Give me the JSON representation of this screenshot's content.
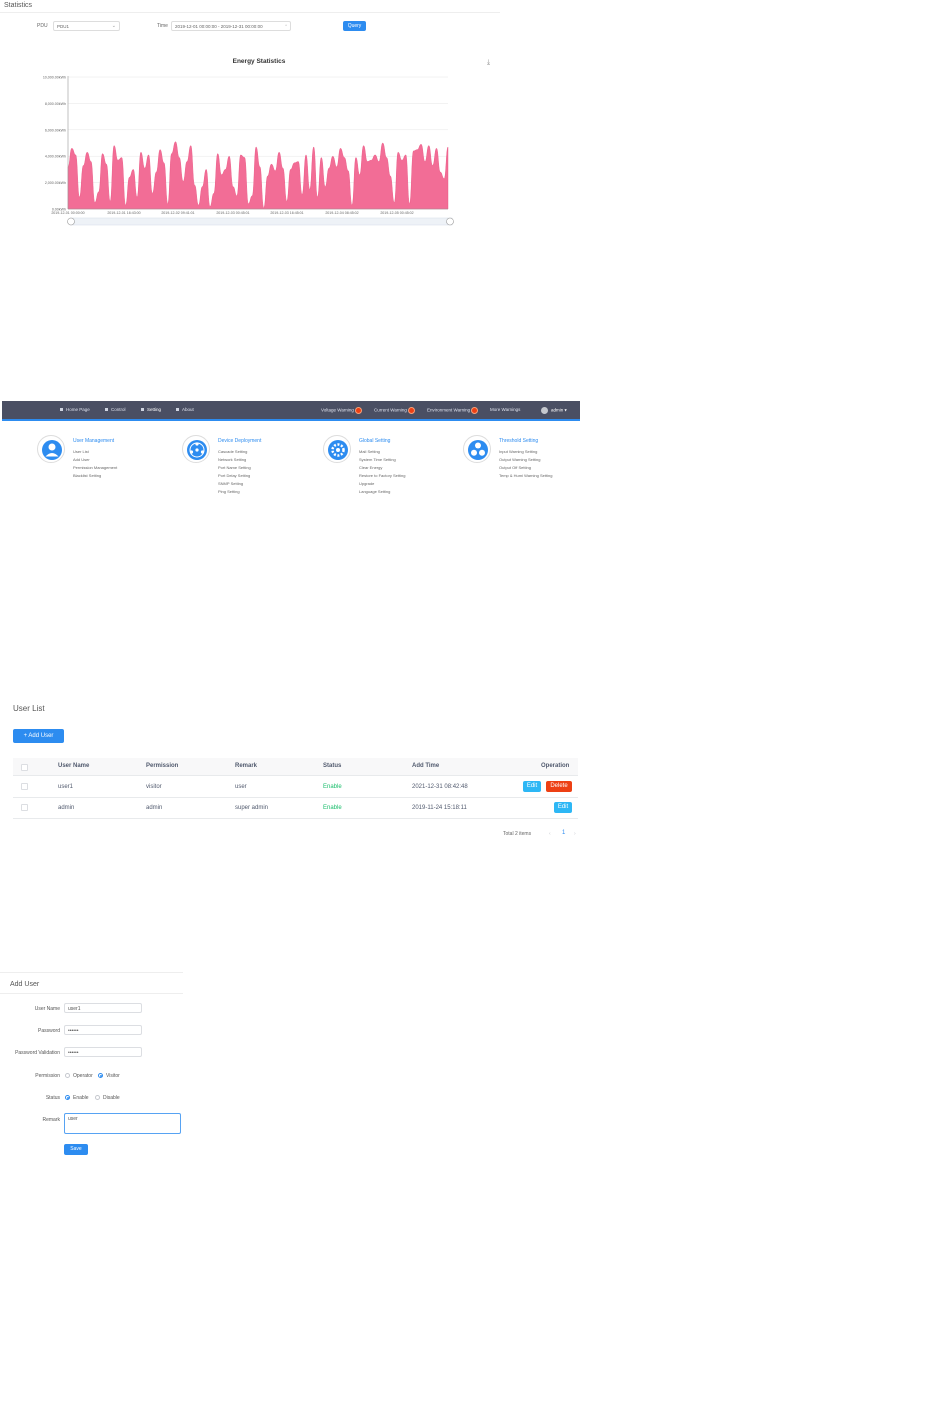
{
  "statistics": {
    "title": "Statistics",
    "pdu_label": "PDU",
    "pdu_value": "PDU1",
    "time_label": "Time",
    "time_value": "2019-12-01 00:00:00 - 2019-12-31 00:00:00",
    "query_label": "Query",
    "download_icon": "download-icon"
  },
  "chart_data": {
    "type": "area",
    "title": "Energy Statistics",
    "ylabel": "",
    "xlabel": "",
    "ylim": [
      0,
      10000
    ],
    "yticks": [
      "0.00kWh",
      "2,000.00kWh",
      "4,000.00kWh",
      "6,000.00kWh",
      "8,000.00kWh",
      "10,000.00kWh"
    ],
    "xticks": [
      "2019-12-01 00:00:00",
      "2019-12-01 16:43:00",
      "2019-12-02 09:41:01",
      "2019-12-03 00:45:01",
      "2019-12-03 16:45:01",
      "2019-12-04 08:45:02",
      "2019-12-05 00:45:02"
    ],
    "color": "#f26d96",
    "series": [
      {
        "values": [
          3200,
          4600,
          4100,
          900,
          3300,
          4300,
          3600,
          500,
          1300,
          4200,
          3400,
          600,
          4800,
          3700,
          3900,
          300,
          2400,
          3000,
          900,
          4300,
          3100,
          4100,
          1200,
          2800,
          4500,
          3500,
          400,
          4200,
          5100,
          3900,
          2100,
          3600,
          4800,
          1800,
          300,
          1700,
          3000,
          200,
          1200,
          4200,
          2600,
          3000,
          4000,
          1700,
          1000,
          4100,
          3900,
          400,
          1000,
          4700,
          3200,
          100,
          2500,
          3400,
          2900,
          4300,
          3100,
          600,
          3000,
          3500,
          3600,
          1100,
          4100,
          1500,
          4700,
          900,
          3900,
          1700,
          3100,
          4000,
          3200,
          4600,
          3900,
          2900,
          300,
          3900,
          2600,
          4800,
          3600,
          3700,
          4100,
          3600,
          5000,
          3900,
          2500,
          500,
          4300,
          3700,
          4100,
          400,
          4400,
          4500,
          4900,
          3600,
          4800,
          3300,
          4600,
          2800,
          2300,
          4700
        ]
      }
    ]
  },
  "nav": {
    "home": "Home Page",
    "control": "Control",
    "setting": "Setting",
    "about": "About",
    "voltage": "Voltage Warning",
    "current": "Current Warning",
    "environment": "Environment Warning",
    "more": "More Warnings",
    "user": "admin ▾"
  },
  "groups": [
    {
      "title": "User Management",
      "items": [
        "User List",
        "Add User",
        "Permission Management",
        "Blacklist Setting"
      ],
      "icon": "user-icon"
    },
    {
      "title": "Device Deployment",
      "items": [
        "Cascade Setting",
        "Network Setting",
        "Port Name Setting",
        "Port Delay Setting",
        "SNMP Setting",
        "Ping Setting"
      ],
      "icon": "network-icon"
    },
    {
      "title": "Global Setting",
      "items": [
        "Mail Setting",
        "System Time Setting",
        "Clear Energy",
        "Restore to Factory Setting",
        "Upgrade",
        "Language Setting"
      ],
      "icon": "gear-icon"
    },
    {
      "title": "Threshold Setting",
      "items": [
        "Input Warning Setting",
        "Output Warning Setting",
        "Output Off Setting",
        "Temp & Humi Warning Setting"
      ],
      "icon": "fan-icon"
    }
  ],
  "user_list": {
    "title": "User List",
    "add_button": "+ Add User",
    "columns": [
      "User Name",
      "Permission",
      "Remark",
      "Status",
      "Add Time",
      "Operation"
    ],
    "rows": [
      {
        "name": "user1",
        "permission": "visitor",
        "remark": "user",
        "status": "Enable",
        "time": "2021-12-31 08:42:48",
        "edit": "Edit",
        "delete": "Delete"
      },
      {
        "name": "admin",
        "permission": "admin",
        "remark": "super admin",
        "status": "Enable",
        "time": "2019-11-24 15:18:11",
        "edit": "Edit"
      }
    ],
    "total": "Total 2 items",
    "page": "1",
    "prev": "‹",
    "next": "›"
  },
  "add_user": {
    "title": "Add User",
    "username_label": "User Name",
    "username_value": "user1",
    "password_label": "Password",
    "password_value": "••••••",
    "validation_label": "Password Validation",
    "validation_value": "••••••",
    "permission_label": "Permission",
    "perm_operator": "Operator",
    "perm_visitor": "Visitor",
    "status_label": "Status",
    "status_enable": "Enable",
    "status_disable": "Disable",
    "remark_label": "Remark",
    "remark_value": "user",
    "save_label": "Save"
  }
}
